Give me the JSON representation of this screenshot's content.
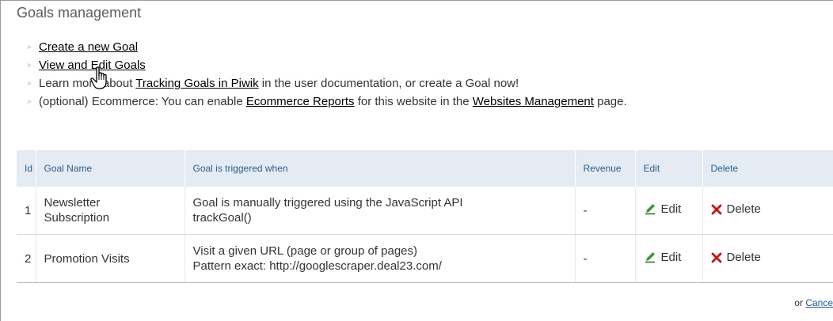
{
  "page": {
    "title": "Goals management"
  },
  "links": {
    "create_goal": "Create a new Goal",
    "view_edit": "View and Edit Goals",
    "learn_prefix": "Learn more about ",
    "learn_link": "Tracking Goals in Piwik",
    "learn_suffix": " in the user documentation, or create a Goal now!",
    "ecom_prefix": "(optional) Ecommerce: You can enable ",
    "ecom_link": "Ecommerce Reports",
    "ecom_middle": " for this website in the ",
    "websites_link": "Websites Management",
    "ecom_suffix": " page.",
    "bullet": "»"
  },
  "table": {
    "headers": {
      "id": "Id",
      "name": "Goal Name",
      "trigger": "Goal is triggered when",
      "revenue": "Revenue",
      "edit": "Edit",
      "delete": "Delete"
    },
    "rows": [
      {
        "id": "1",
        "name_line1": "Newsletter",
        "name_line2": "Subscription",
        "trigger_line1": "Goal is manually triggered using the JavaScript API",
        "trigger_line2": "trackGoal()",
        "revenue": "-",
        "edit": "Edit",
        "delete": "Delete"
      },
      {
        "id": "2",
        "name_line1": "Promotion Visits",
        "name_line2": "",
        "trigger_line1": "Visit a given URL (page or group of pages)",
        "trigger_line2": "Pattern exact: http://googlescraper.deal23.com/",
        "revenue": "-",
        "edit": "Edit",
        "delete": "Delete"
      }
    ]
  },
  "footer": {
    "or_text": "or ",
    "cancel": "Cance"
  },
  "colors": {
    "header_bg": "#e4ebf2",
    "header_text": "#2a5f8f",
    "edit_icon": "#2e9e2e",
    "delete_icon": "#cc1111",
    "cancel_link": "#1b56c5"
  },
  "icons": {
    "cursor": "hand-pointer-cursor-icon",
    "edit": "pencil-icon",
    "delete": "red-x-icon"
  }
}
